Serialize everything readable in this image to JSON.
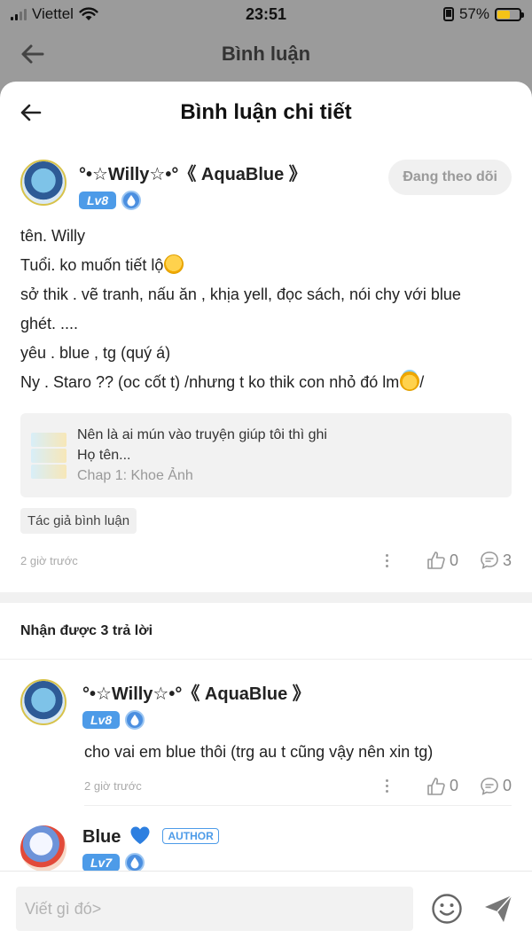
{
  "status_bar": {
    "carrier": "Viettel",
    "time": "23:51",
    "battery_percent": "57%",
    "battery_level": 0.57
  },
  "background_header": {
    "title": "Bình luận"
  },
  "sheet": {
    "title": "Bình luận chi tiết"
  },
  "comment": {
    "username": "°•☆Willy☆•°《 AquaBlue 》",
    "level": "Lv8",
    "follow_label": "Đang theo dõi",
    "lines": [
      "tên. Willy",
      "Tuổi. ko muốn tiết lộ",
      "sở thik . vẽ tranh, nấu ăn , khịa yell, đọc sách, nói chy với blue",
      "ghét. ....",
      "yêu . blue , tg (quý á)",
      "Ny . Staro ?? (oc cốt t) /nhưng t ko thik con nhỏ đó lm",
      "/"
    ],
    "story": {
      "line1": "Nên là ai mún vào truyện giúp tôi thì ghi",
      "line2": "Họ tên...",
      "chapter": "Chap 1: Khoe Ảnh"
    },
    "author_tag": "Tác giả bình luận",
    "time": "2 giờ trước",
    "likes": "0",
    "replies": "3"
  },
  "replies_title": "Nhận được 3 trả lời",
  "replies": [
    {
      "username": "°•☆Willy☆•°《 AquaBlue 》",
      "level": "Lv8",
      "text": "cho vai em blue thôi (trg au t cũng vậy nên xin tg)",
      "time": "2 giờ trước",
      "likes": "0",
      "replies": "0"
    },
    {
      "username": "Blue",
      "author_badge": "AUTHOR",
      "level": "Lv7"
    }
  ],
  "input": {
    "placeholder": "Viết gì đó>"
  },
  "icons": {
    "back": "arrow-left-icon",
    "smile": "smile-icon",
    "send": "send-icon",
    "like": "thumb-up-icon",
    "comment": "comment-bubble-icon",
    "more": "more-vertical-icon",
    "water_drop": "water-drop-icon",
    "heart": "heart-icon"
  },
  "colors": {
    "accent_blue": "#4d9be8",
    "overlay_gray": "#9b9b9b",
    "battery_yellow": "#f3c318"
  }
}
